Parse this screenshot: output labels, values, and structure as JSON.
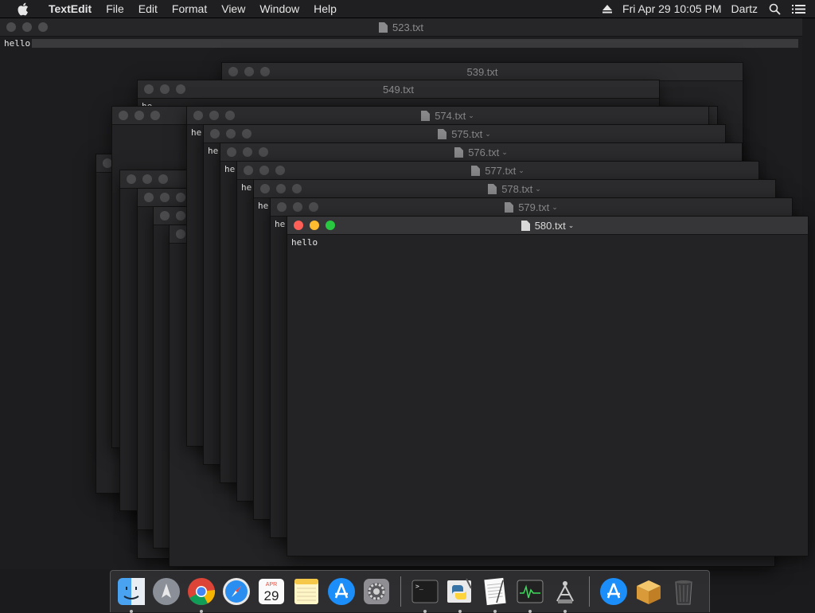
{
  "menubar": {
    "app_name": "TextEdit",
    "items": [
      "File",
      "Edit",
      "Format",
      "View",
      "Window",
      "Help"
    ],
    "datetime": "Fri Apr 29  10:05 PM",
    "user": "Dartz",
    "icons": [
      "apple-icon",
      "eject-icon",
      "search-icon",
      "notification-list-icon"
    ]
  },
  "back_window": {
    "title": "523.txt",
    "text": "hello"
  },
  "windows": [
    {
      "title": "539.txt",
      "text": ""
    },
    {
      "title": "549.txt",
      "text": "he"
    },
    {
      "title": "574.txt",
      "text": "he"
    },
    {
      "title": "575.txt",
      "text": "he"
    },
    {
      "title": "576.txt",
      "text": "he"
    },
    {
      "title": "577.txt",
      "text": "he"
    },
    {
      "title": "578.txt",
      "text": "he"
    },
    {
      "title": "579.txt",
      "text": "he"
    },
    {
      "title": "580.txt",
      "text": "hello"
    }
  ],
  "dock": {
    "apps": [
      {
        "name": "Finder",
        "running": true
      },
      {
        "name": "Launchpad",
        "running": false
      },
      {
        "name": "Google Chrome",
        "running": true
      },
      {
        "name": "Safari",
        "running": false
      },
      {
        "name": "Calendar",
        "running": false,
        "month": "APR",
        "day": "29"
      },
      {
        "name": "Notes",
        "running": false
      },
      {
        "name": "App Store",
        "running": false
      },
      {
        "name": "System Preferences",
        "running": false
      },
      {
        "name": "Terminal",
        "running": true
      },
      {
        "name": "Python Launcher",
        "running": true
      },
      {
        "name": "TextEdit",
        "running": true
      },
      {
        "name": "Activity Monitor",
        "running": true
      },
      {
        "name": "Directory Utility",
        "running": true
      },
      {
        "name": "App Store Folder",
        "running": false
      },
      {
        "name": "Archive Utility",
        "running": false
      },
      {
        "name": "Trash",
        "running": false
      }
    ]
  },
  "colors": {
    "close": "#ff5f57",
    "minimize": "#febc2e",
    "maximize": "#28c840",
    "window_bg": "#232325",
    "desktop": "#1b1b1d"
  }
}
